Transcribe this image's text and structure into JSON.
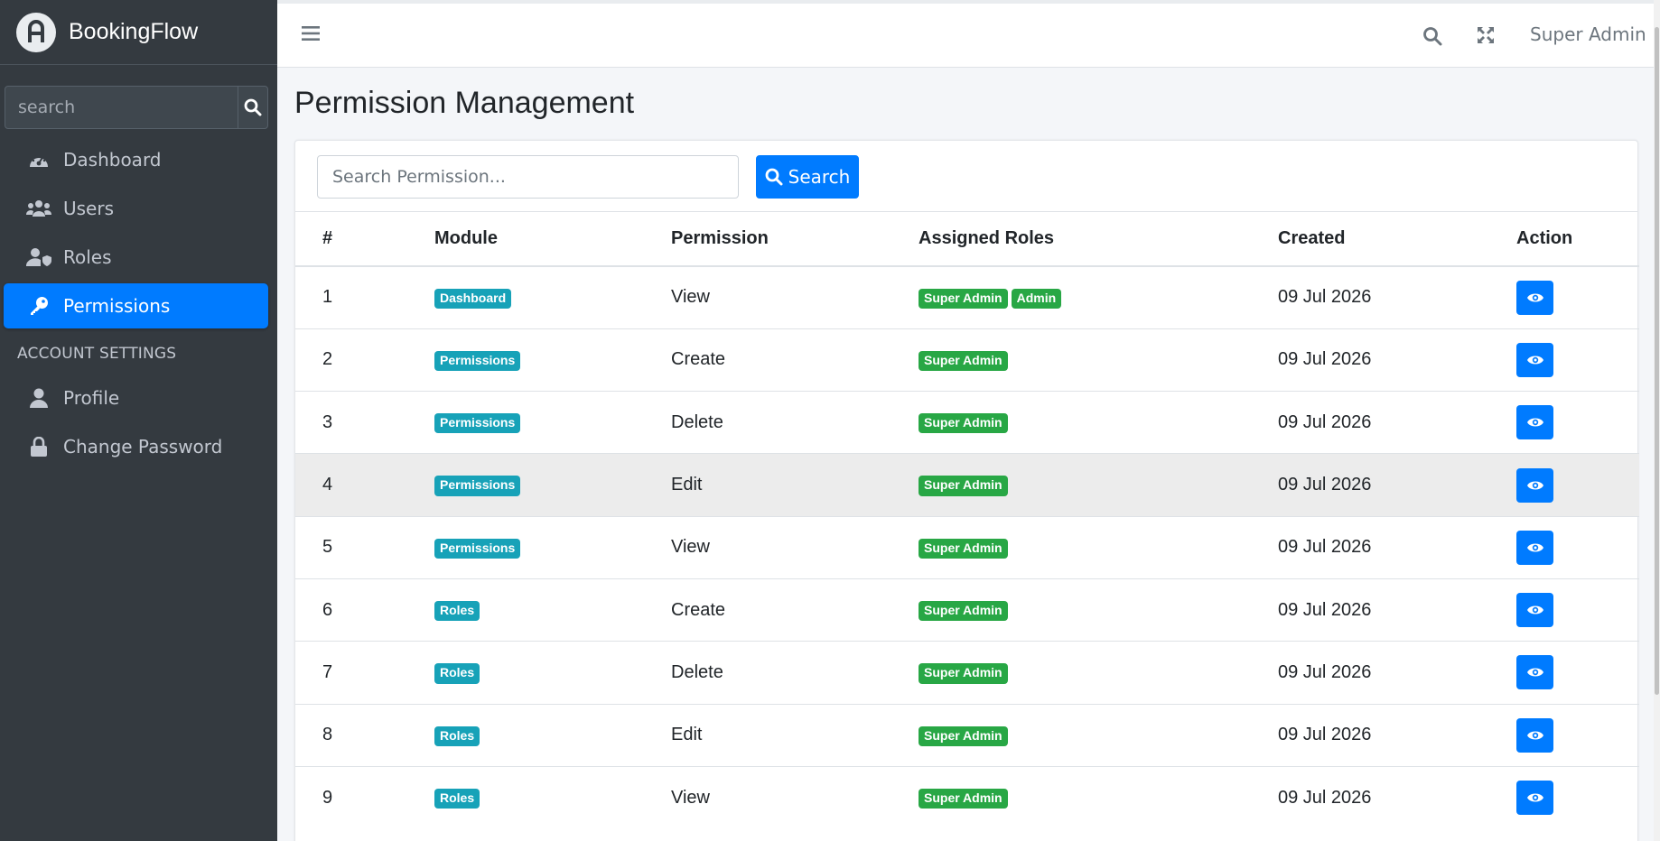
{
  "sidebar": {
    "brand_name": "BookingFlow",
    "search_placeholder": "search",
    "items": [
      {
        "label": "Dashboard",
        "icon": "tachometer-icon",
        "active": false
      },
      {
        "label": "Users",
        "icon": "users-icon",
        "active": false
      },
      {
        "label": "Roles",
        "icon": "user-shield-icon",
        "active": false
      },
      {
        "label": "Permissions",
        "icon": "key-icon",
        "active": true
      }
    ],
    "section_header": "ACCOUNT SETTINGS",
    "account_items": [
      {
        "label": "Profile",
        "icon": "user-icon"
      },
      {
        "label": "Change Password",
        "icon": "lock-icon"
      }
    ]
  },
  "topbar": {
    "user_name": "Super Admin"
  },
  "page": {
    "title": "Permission Management",
    "search_placeholder": "Search Permission...",
    "search_button": "Search"
  },
  "table": {
    "headers": [
      "#",
      "Module",
      "Permission",
      "Assigned Roles",
      "Created",
      "Action"
    ],
    "rows": [
      {
        "num": "1",
        "module": "Dashboard",
        "permission": "View",
        "roles": [
          "Super Admin",
          "Admin"
        ],
        "created": "09 Jul 2026"
      },
      {
        "num": "2",
        "module": "Permissions",
        "permission": "Create",
        "roles": [
          "Super Admin"
        ],
        "created": "09 Jul 2026"
      },
      {
        "num": "3",
        "module": "Permissions",
        "permission": "Delete",
        "roles": [
          "Super Admin"
        ],
        "created": "09 Jul 2026"
      },
      {
        "num": "4",
        "module": "Permissions",
        "permission": "Edit",
        "roles": [
          "Super Admin"
        ],
        "created": "09 Jul 2026"
      },
      {
        "num": "5",
        "module": "Permissions",
        "permission": "View",
        "roles": [
          "Super Admin"
        ],
        "created": "09 Jul 2026"
      },
      {
        "num": "6",
        "module": "Roles",
        "permission": "Create",
        "roles": [
          "Super Admin"
        ],
        "created": "09 Jul 2026"
      },
      {
        "num": "7",
        "module": "Roles",
        "permission": "Delete",
        "roles": [
          "Super Admin"
        ],
        "created": "09 Jul 2026"
      },
      {
        "num": "8",
        "module": "Roles",
        "permission": "Edit",
        "roles": [
          "Super Admin"
        ],
        "created": "09 Jul 2026"
      },
      {
        "num": "9",
        "module": "Roles",
        "permission": "View",
        "roles": [
          "Super Admin"
        ],
        "created": "09 Jul 2026"
      }
    ]
  },
  "colors": {
    "sidebar_bg": "#343a40",
    "primary": "#007bff",
    "module_badge": "#17a2b8",
    "role_badge": "#28a745"
  }
}
